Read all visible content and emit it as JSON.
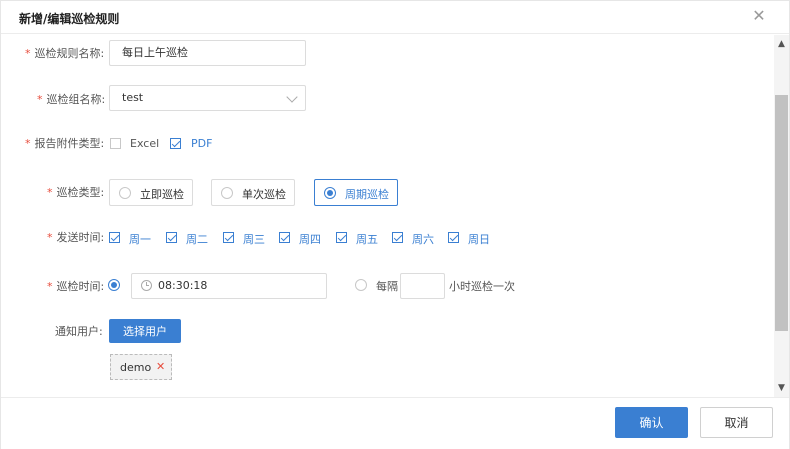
{
  "dialog": {
    "title": "新增/编辑巡检规则",
    "close_glyph": "✕"
  },
  "form": {
    "rule_name": {
      "label": "巡检规则名称:",
      "value": "每日上午巡检"
    },
    "group_name": {
      "label": "巡检组名称:",
      "value": "test"
    },
    "attachment_type": {
      "label": "报告附件类型:",
      "options": [
        {
          "label": "Excel",
          "checked": false
        },
        {
          "label": "PDF",
          "checked": true
        }
      ]
    },
    "inspection_type": {
      "label": "巡检类型:",
      "options": [
        {
          "label": "立即巡检",
          "selected": false
        },
        {
          "label": "单次巡检",
          "selected": false
        },
        {
          "label": "周期巡检",
          "selected": true
        }
      ]
    },
    "send_time": {
      "label": "发送时间:",
      "days": [
        {
          "label": "周一",
          "checked": true
        },
        {
          "label": "周二",
          "checked": true
        },
        {
          "label": "周三",
          "checked": true
        },
        {
          "label": "周四",
          "checked": true
        },
        {
          "label": "周五",
          "checked": true
        },
        {
          "label": "周六",
          "checked": true
        },
        {
          "label": "周日",
          "checked": true
        }
      ]
    },
    "inspection_time": {
      "label": "巡检时间:",
      "time_value": "08:30:18",
      "every_label": "每隔",
      "interval_value": "",
      "interval_suffix": "小时巡检一次",
      "fixed_selected": true
    },
    "notify_users": {
      "label": "通知用户:",
      "select_button": "选择用户",
      "tags": [
        {
          "label": "demo",
          "remove_glyph": "✕"
        }
      ]
    },
    "required_mark": "*"
  },
  "scrollbar": {
    "up_glyph": "▲",
    "down_glyph": "▼"
  },
  "footer": {
    "confirm_label": "确认",
    "cancel_label": "取消"
  },
  "colors": {
    "accent": "#3a7fd2",
    "required": "#e74c3c",
    "border": "#dcdcdc"
  }
}
